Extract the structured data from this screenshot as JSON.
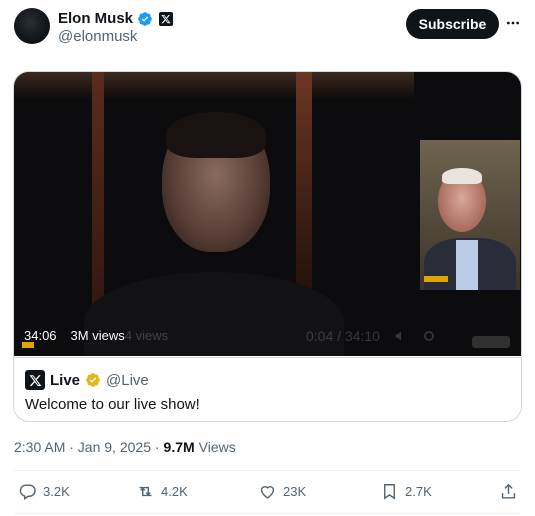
{
  "author": {
    "name": "Elon Musk",
    "handle": "@elonmusk"
  },
  "header": {
    "subscribe_label": "Subscribe",
    "more_icon": "more-dots-icon"
  },
  "media": {
    "duration": "34:06",
    "views": "3M views",
    "ghost_views": "4 views",
    "ghost_time": "0:04 / 34:10"
  },
  "quoted": {
    "name": "Live",
    "handle": "@Live",
    "text": "Welcome to our live show!"
  },
  "meta": {
    "timestamp": "2:30 AM · Jan 9, 2025 ·",
    "views_count": "9.7M",
    "views_label": "Views"
  },
  "actions": {
    "reply": "3.2K",
    "repost": "4.2K",
    "like": "23K",
    "bookmark": "2.7K"
  },
  "colors": {
    "verified_blue": "#1d9bf0",
    "verified_gold": "#e2b719",
    "text_primary": "#0f1419",
    "text_secondary": "#536471"
  }
}
